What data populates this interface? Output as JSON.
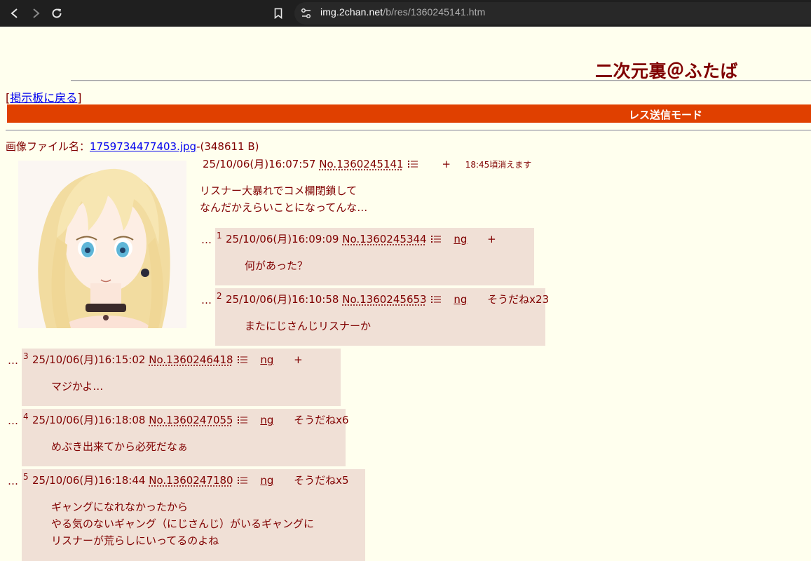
{
  "browser": {
    "url_host": "img.2chan.net",
    "url_path": "/b/res/1360245141.htm"
  },
  "page": {
    "board_title": "二次元裏＠ふたば",
    "back_link_open": "[",
    "back_link": "掲示板に戻る",
    "back_link_close": "]",
    "mode_label": "レス送信モード"
  },
  "op": {
    "file_label": "画像ファイル名：",
    "file_name": "1759734477403.jpg",
    "file_size": "-(348611 B)",
    "date": "25/10/06(月)16:07:57",
    "no": "No.1360245141",
    "plus": "+",
    "expire": "18:45頃消えます",
    "body_lines": [
      "リスナー大暴れでコメ欄閉鎖して",
      "なんだかえらいことになってんな…"
    ]
  },
  "replies": [
    {
      "dots": "…",
      "num": "1",
      "date": "25/10/06(月)16:09:09",
      "no": "No.1360245344",
      "ng": "ng",
      "extra": "+",
      "extra_type": "plus",
      "body": [
        "何があった？"
      ]
    },
    {
      "dots": "…",
      "num": "2",
      "date": "25/10/06(月)16:10:58",
      "no": "No.1360245653",
      "ng": "ng",
      "extra": "そうだねx23",
      "extra_type": "sodane",
      "body": [
        "またにじさんじリスナーか"
      ]
    },
    {
      "dots": "…",
      "num": "3",
      "date": "25/10/06(月)16:15:02",
      "no": "No.1360246418",
      "ng": "ng",
      "extra": "+",
      "extra_type": "plus",
      "body": [
        "マジかよ…"
      ]
    },
    {
      "dots": "…",
      "num": "4",
      "date": "25/10/06(月)16:18:08",
      "no": "No.1360247055",
      "ng": "ng",
      "extra": "そうだねx6",
      "extra_type": "sodane",
      "body": [
        "めぶき出来てから必死だなぁ"
      ]
    },
    {
      "dots": "…",
      "num": "5",
      "date": "25/10/06(月)16:18:44",
      "no": "No.1360247180",
      "ng": "ng",
      "extra": "そうだねx5",
      "extra_type": "sodane",
      "body": [
        "ギャングになれなかったから",
        "やる気のないギャング（にじさんじ）がいるギャングに",
        "リスナーが荒らしにいってるのよね"
      ]
    }
  ],
  "colors": {
    "background": "#ffffee",
    "text": "#800000",
    "reply_bg": "#f0e0d6",
    "mode_bar": "#e04000",
    "link": "#0000ee"
  }
}
